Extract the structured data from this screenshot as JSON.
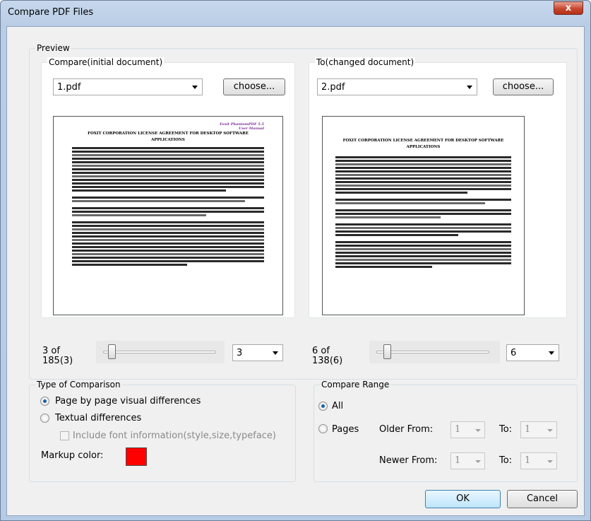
{
  "window": {
    "title": "Compare PDF Files",
    "close_label": "x"
  },
  "preview": {
    "label": "Preview",
    "left": {
      "label": "Compare(initial document)",
      "file": "1.pdf",
      "choose_label": "choose...",
      "doc_header": "Foxit PhantomPDF 5.5\nUser Manual",
      "doc_title": "FOXIT CORPORATION LICENSE AGREEMENT FOR DESKTOP SOFTWARE APPLICATIONS",
      "page_info": "3  of\n185(3)",
      "page_value": "3",
      "slider_fraction": 0.05
    },
    "right": {
      "label": "To(changed document)",
      "file": "2.pdf",
      "choose_label": "choose...",
      "doc_title": "FOXIT CORPORATION LICENSE AGREEMENT FOR DESKTOP SOFTWARE APPLICATIONS",
      "page_info": "6  of\n138(6)",
      "page_value": "6",
      "slider_fraction": 0.07
    }
  },
  "comparison": {
    "label": "Type of Comparison",
    "option_visual": "Page by page visual differences",
    "option_textual": "Textual differences",
    "include_font": "Include font information(style,size,typeface)",
    "markup_label": "Markup color:",
    "markup_color": "#ff0000",
    "selected": "visual"
  },
  "range": {
    "label": "Compare Range",
    "all_label": "All",
    "pages_label": "Pages",
    "older_from_label": "Older From:",
    "newer_from_label": "Newer From:",
    "to_label": "To:",
    "older_from": "1",
    "older_to": "1",
    "newer_from": "1",
    "newer_to": "1",
    "selected": "all"
  },
  "buttons": {
    "ok": "OK",
    "cancel": "Cancel"
  }
}
